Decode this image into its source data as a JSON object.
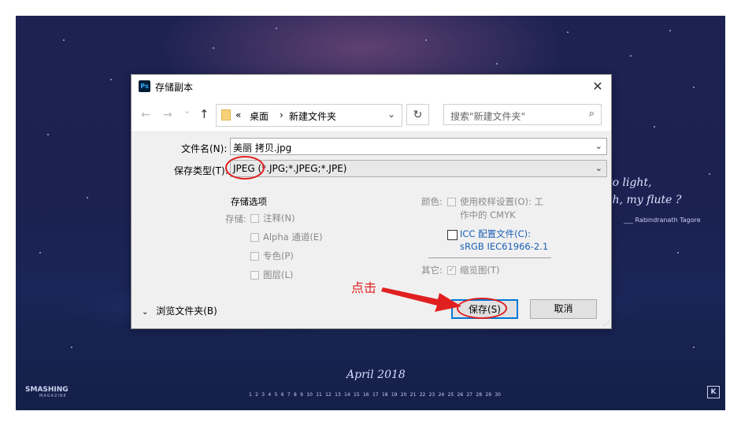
{
  "wallpaper": {
    "quote_line1": "to light,",
    "quote_line2": "th, my flute ?",
    "quote_author": "___ Rabindranath Tagore",
    "calendar_title": "April 2018",
    "calendar_days": [
      "1",
      "2",
      "3",
      "4",
      "5",
      "6",
      "7",
      "8",
      "9",
      "10",
      "11",
      "12",
      "13",
      "14",
      "15",
      "16",
      "17",
      "18",
      "19",
      "20",
      "21",
      "22",
      "23",
      "24",
      "25",
      "26",
      "27",
      "28",
      "29",
      "30"
    ],
    "brand": "SMASHING",
    "brand_sub": "MAGAZINE",
    "corner_logo": "K"
  },
  "dialog": {
    "app_icon_text": "Ps",
    "title": "存储副本",
    "close_label": "✕",
    "nav": {
      "back": "←",
      "forward": "→",
      "recent": "⌄",
      "up": "↑",
      "breadcrumb_sep_root": "«",
      "breadcrumb": [
        "桌面",
        "新建文件夹"
      ],
      "breadcrumb_sep": "›",
      "refresh": "↻",
      "search_placeholder": "搜索\"新建文件夹\"",
      "search_icon": "⌕"
    },
    "filename_label": "文件名(N):",
    "filename_value": "美丽 拷贝.jpg",
    "filetype_label": "保存类型(T):",
    "filetype_value": "JPEG (*.JPG;*.JPEG;*.JPE)",
    "options": {
      "section_title": "存储选项",
      "storage_label": "存储:",
      "annotation": "注释(N)",
      "alpha": "Alpha 通道(E)",
      "spot": "专色(P)",
      "layers": "图层(L)",
      "color_label": "颜色:",
      "proof_line1": "使用校样设置(O):  工",
      "proof_line2": "作中的 CMYK",
      "icc_line1": "ICC 配置文件(C):",
      "icc_line2": "sRGB IEC61966-2.1",
      "other_label": "其它:",
      "thumbnail": "缩览图(T)",
      "thumbnail_checked": true,
      "icc_checked": false
    },
    "browse_label": "浏览文件夹(B)",
    "save_button": "保存(S)",
    "cancel_button": "取消"
  },
  "annotation": {
    "click_text": "点击",
    "color": "#e02020"
  }
}
